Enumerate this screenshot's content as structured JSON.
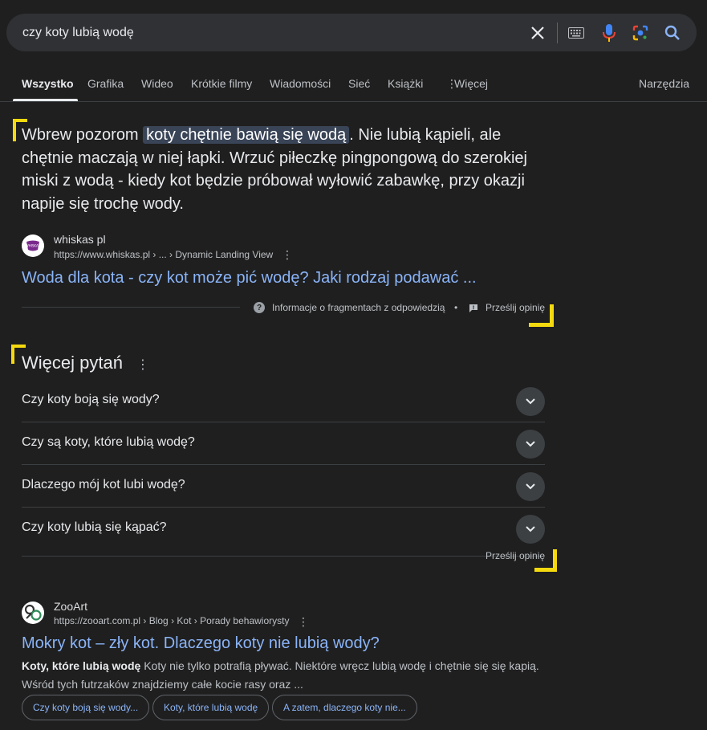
{
  "search": {
    "query": "czy koty lubią wodę"
  },
  "tabs": [
    "Wszystko",
    "Grafika",
    "Wideo",
    "Krótkie filmy",
    "Wiadomości",
    "Sieć",
    "Książki",
    "Więcej"
  ],
  "tools_label": "Narzędzia",
  "snippet": {
    "before": "Wbrew pozorom ",
    "highlight": "koty chętnie bawią się wodą",
    "after": ". Nie lubią kąpieli, ale chętnie maczają w niej łapki. Wrzuć piłeczkę pingpongową do szerokiej miski z wodą - kiedy kot będzie próbował wyłowić zabawkę, przy okazji napije się trochę wody."
  },
  "result1": {
    "site": "whiskas pl",
    "url": "https://www.whiskas.pl › ... › Dynamic Landing View",
    "title": "Woda dla kota - czy kot może pić wodę? Jaki rodzaj podawać ...",
    "favicon_text": "WHISKAS"
  },
  "snippet_footer": {
    "info": "Informacje o fragmentach z odpowiedzią",
    "bullet": "•",
    "feedback": "Prześlij opinię"
  },
  "paa": {
    "title": "Więcej pytań",
    "questions": [
      "Czy koty boją się wody?",
      "Czy są koty, które lubią wodę?",
      "Dlaczego mój kot lubi wodę?",
      "Czy koty lubią się kąpać?"
    ],
    "feedback": "Prześlij opinię"
  },
  "result2": {
    "site": "ZooArt",
    "url": "https://zooart.com.pl › Blog › Kot › Porady behawiorysty",
    "title": "Mokry kot – zły kot. Dlaczego koty nie lubią wody?",
    "desc_bold": "Koty, które lubią wodę",
    "desc_rest": " Koty nie tylko potrafią pływać. Niektóre wręcz lubią wodę i chętnie się się kapią. Wśród tych futrzaków znajdziemy całe kocie rasy oraz ...",
    "chips": [
      "Czy koty boją się wody...",
      "Koty, które lubią wodę",
      "A zatem, dlaczego koty nie..."
    ]
  },
  "colors": {
    "background": "#1f1f1f",
    "link": "#8ab4f8",
    "marker": "#f5d90f",
    "highlight": "#394457"
  },
  "icons": [
    "close-icon",
    "keyboard-icon",
    "mic-icon",
    "lens-icon",
    "search-icon",
    "more-vert-icon",
    "help-icon",
    "feedback-icon",
    "chevron-down-icon"
  ]
}
